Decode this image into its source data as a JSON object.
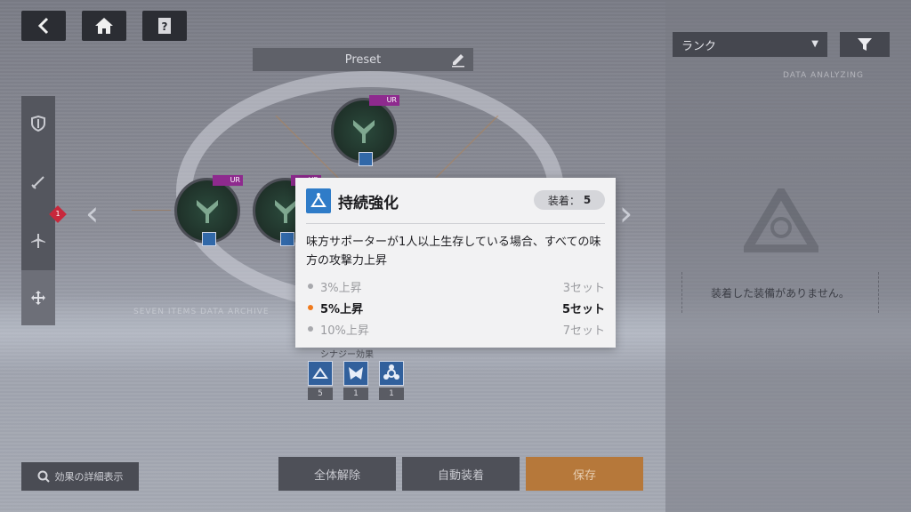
{
  "top_bar": {
    "back_icon": "chevron-left-icon",
    "home_icon": "home-icon",
    "help_icon": "help-book-icon"
  },
  "preset": {
    "label": "Preset",
    "edit_icon": "pencil-icon"
  },
  "side_tabs": [
    {
      "icon": "shield-icon"
    },
    {
      "icon": "sword-icon"
    },
    {
      "icon": "aircraft-icon"
    },
    {
      "icon": "move-arrows-icon",
      "active": true
    }
  ],
  "side_badge": "1",
  "nodes": [
    {
      "rarity": "UR"
    },
    {
      "rarity": "UR"
    },
    {
      "rarity": "UR"
    }
  ],
  "background_text": {
    "seven_items": "SEVEN ITEMS DATA ARCHIVE"
  },
  "set_effects": {
    "label": "シナジー効果",
    "items": [
      {
        "icon": "support-icon",
        "count": "5"
      },
      {
        "icon": "wing-icon",
        "count": "1"
      },
      {
        "icon": "biohazard-icon",
        "count": "1"
      }
    ]
  },
  "bottom": {
    "detail_label": "効果の詳細表示",
    "release_all": "全体解除",
    "auto_equip": "自動装着",
    "save": "保存"
  },
  "right_panel": {
    "sort_value": "ランク",
    "filter_icon": "filter-icon",
    "data_analyzing": "DATA ANALYZING",
    "empty_message": "装着した装備がありません。"
  },
  "popup": {
    "title": "持続強化",
    "equip_label": "装着：",
    "equip_count": "5",
    "description": "味方サポーターが1人以上生存している場合、すべての味方の攻撃力上昇",
    "tiers": [
      {
        "name": "3%上昇",
        "sets": "3セット",
        "active": false
      },
      {
        "name": "5%上昇",
        "sets": "5セット",
        "active": true
      },
      {
        "name": "10%上昇",
        "sets": "7セット",
        "active": false
      }
    ]
  },
  "colors": {
    "accent_orange": "#f07a1c",
    "popup_icon_blue": "#2f7cc8",
    "badge_red": "#c8283c",
    "save_orange": "#b6783a"
  }
}
